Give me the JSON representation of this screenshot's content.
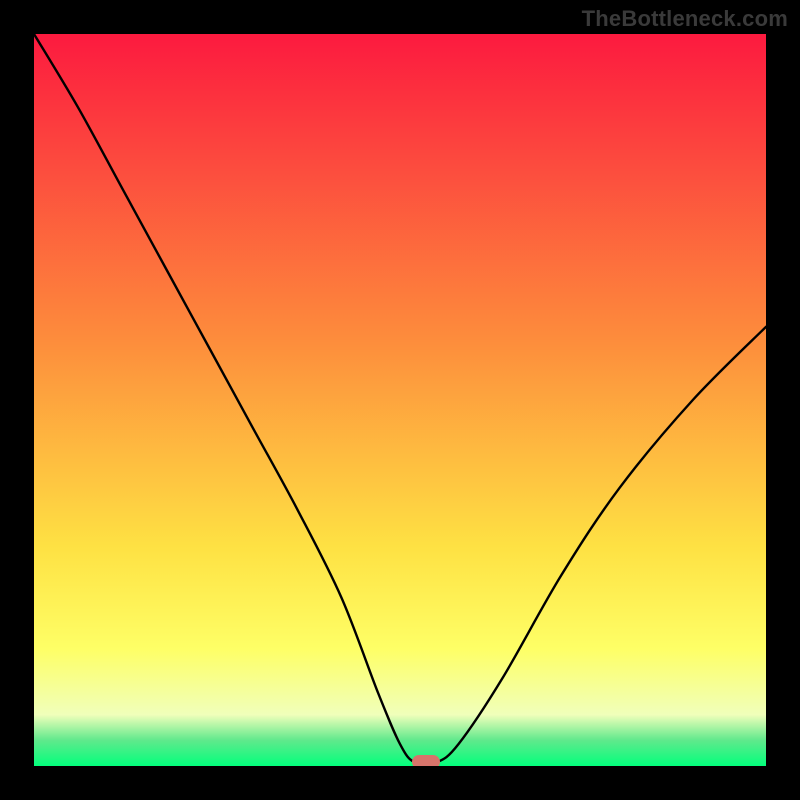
{
  "watermark": "TheBottleneck.com",
  "colors": {
    "frame": "#000000",
    "curve": "#000000",
    "marker": "#d7746b",
    "watermark_text": "#3a3a3a",
    "gradient": {
      "top": "#fc1a3f",
      "upper_mid": "#fd8d3c",
      "mid": "#fee143",
      "lower_mid": "#feff66",
      "pale": "#f0ffba",
      "thin_green": "#5fe98c",
      "bottom": "#03ff7c"
    }
  },
  "chart_data": {
    "type": "line",
    "title": "",
    "xlabel": "",
    "ylabel": "",
    "xlim": [
      0,
      100
    ],
    "ylim": [
      0,
      100
    ],
    "series": [
      {
        "name": "bottleneck-curve",
        "x": [
          0,
          6,
          12,
          18,
          24,
          30,
          36,
          42,
          47,
          50,
          52,
          55,
          58,
          64,
          72,
          80,
          90,
          100
        ],
        "y": [
          100,
          90,
          79,
          68,
          57,
          46,
          35,
          23,
          10,
          3,
          0.5,
          0.5,
          3,
          12,
          26,
          38,
          50,
          60
        ]
      }
    ],
    "marker": {
      "x": 53.5,
      "y": 0.5
    },
    "gradient_stops": [
      {
        "offset": 0,
        "value": 100
      },
      {
        "offset": 42,
        "value": 58
      },
      {
        "offset": 70,
        "value": 30
      },
      {
        "offset": 84,
        "value": 16
      },
      {
        "offset": 93,
        "value": 7
      },
      {
        "offset": 96.5,
        "value": 3.5
      },
      {
        "offset": 100,
        "value": 0
      }
    ]
  }
}
